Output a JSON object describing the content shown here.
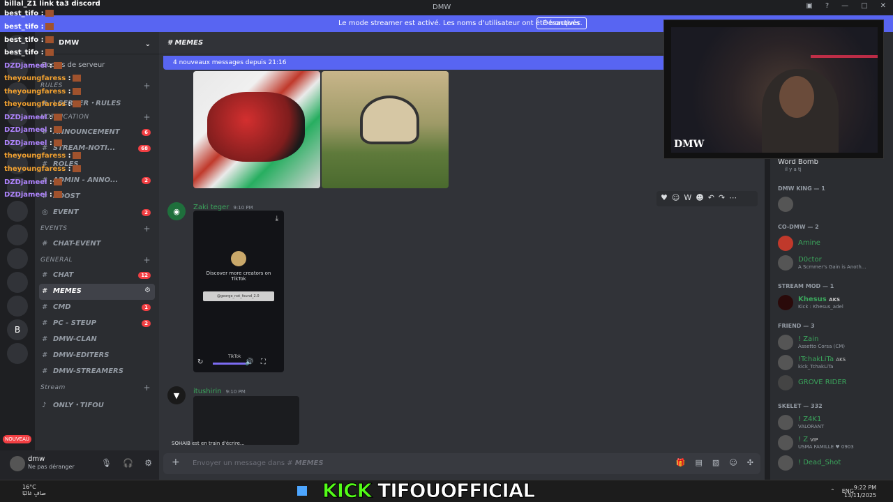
{
  "window": {
    "title": "DMW"
  },
  "banner": {
    "text": "Le mode streamer est activé. Les noms d'utilisateur ont été tronqués.",
    "button": "Désactiver"
  },
  "server": {
    "name": "DMW",
    "boost": "Boosts de serveur"
  },
  "categories": {
    "rules": "RULES",
    "notification": "NOTIFICATION",
    "events": "EVENTS",
    "general": "GENERAL",
    "stream": "Stream"
  },
  "channels": {
    "server_rules": "| SERVER・RULES",
    "announcement": "ANNOUNCEMENT",
    "announcement_badge": "6",
    "stream_noti": "STREAM-NOTI...",
    "stream_noti_badge": "68",
    "roles": "ROLES",
    "admin_anno": "ADMIN - ANNO...",
    "admin_badge": "2",
    "boost": "BOOST",
    "event": "EVENT",
    "event_badge": "2",
    "chat_event": "CHAT-EVENT",
    "chat": "CHAT",
    "chat_badge": "12",
    "memes": "MEMES",
    "cmd": "CMD",
    "cmd_badge": "1",
    "pc_setup": "PC - STEUP",
    "pc_badge": "2",
    "dmw_clan": "DMW-CLAN",
    "dmw_editers": "DMW-EDITERS",
    "dmw_streamers": "DMW-STREAMERS",
    "only_tifou": "ONLY・TIFOU"
  },
  "user": {
    "name": "dmw",
    "status": "Ne pas déranger"
  },
  "chat": {
    "channel": "MEMES",
    "new_messages": "4 nouveaux messages depuis 21:16",
    "msg1": {
      "author": "Zaki teger",
      "time": "9:10 PM"
    },
    "msg2": {
      "author": "itushirin",
      "time": "9:10 PM"
    },
    "tiktok": {
      "title": "Discover more creators on TikTok",
      "search": "@george_not_found_2.0",
      "brand": "TikTok"
    },
    "typing": "SOHAIB est en train d'écrire...",
    "input_placeholder": "Envoyer un message dans #",
    "input_channel": "MEMES"
  },
  "members": {
    "top": {
      "name": "Word Bomb",
      "status": "il y a tj"
    },
    "cat_king": "DMW KING — 1",
    "cat_co": "CO-DMW — 2",
    "amine": "Amine",
    "doctor": "D0ctor",
    "doctor_status": "A Scmmer's Gain is Anoth...",
    "cat_streammod": "STREAM MOD — 1",
    "khesus": "Khesus",
    "khesus_tag": "AKS",
    "khesus_status": "Kick : Khesus_adel",
    "cat_friend": "FRIEND — 3",
    "zain": "! Zain",
    "zain_status": "Assetto Corsa (CM)",
    "tchak": "!TchakLiTa",
    "tchak_tag": "AKS",
    "tchak_status": "kick_TchakLiTa",
    "grove": "GROVE RIDER",
    "cat_skelet": "SKELET — 332",
    "z4k1": "! Z4K1",
    "z4k1_status": "VALORANT",
    "z": "! Z",
    "z_tag": "VIP",
    "z_status": "USMA FAMILLE",
    "z_num": "0903",
    "deadshot": "! Dead_Shot"
  },
  "webcam": {
    "logo": "DMW"
  },
  "stream_chat": [
    {
      "user": "billal_Z1",
      "msg": "link ta3 discord",
      "color": "#ffffff"
    },
    {
      "user": "best_tifo",
      "msg": ":",
      "color": "#ffffff"
    },
    {
      "user": "best_tifo",
      "msg": ":",
      "color": "#ffffff"
    },
    {
      "user": "best_tifo",
      "msg": ":",
      "color": "#ffffff"
    },
    {
      "user": "best_tifo",
      "msg": ":",
      "color": "#ffffff"
    },
    {
      "user": "DZDjameel",
      "msg": ":",
      "color": "#b085ff"
    },
    {
      "user": "theyoungfaress",
      "msg": ":",
      "color": "#f0a030"
    },
    {
      "user": "theyoungfaress",
      "msg": ":",
      "color": "#f0a030"
    },
    {
      "user": "theyoungfaress",
      "msg": ":",
      "color": "#f0a030"
    },
    {
      "user": "DZDjameel",
      "msg": ":",
      "color": "#b085ff"
    },
    {
      "user": "DZDjameel",
      "msg": ":",
      "color": "#b085ff"
    },
    {
      "user": "DZDjameel",
      "msg": ":",
      "color": "#b085ff"
    },
    {
      "user": "theyoungfaress",
      "msg": ":",
      "color": "#f0a030"
    },
    {
      "user": "theyoungfaress",
      "msg": ":",
      "color": "#f0a030"
    },
    {
      "user": "DZDjameel",
      "msg": ":",
      "color": "#b085ff"
    },
    {
      "user": "DZDjameel",
      "msg": ":",
      "color": "#b085ff"
    }
  ],
  "taskbar": {
    "temp": "16°C",
    "weather": "صافٍ غالبًا",
    "kick": "KICK",
    "handle": "TIFOUOFFICIAL",
    "lang": "ENG",
    "time": "9:22 PM",
    "date": "13/11/2025"
  },
  "new_badge": "NOUVEAU",
  "colors": {
    "blurple": "#5865f2",
    "kick_green": "#53fc18",
    "bg": "#313338"
  }
}
